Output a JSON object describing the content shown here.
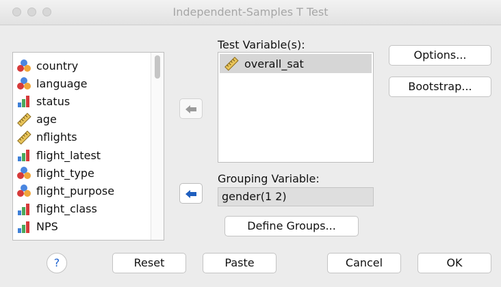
{
  "window": {
    "title": "Independent-Samples T Test"
  },
  "variables": [
    {
      "label": "country",
      "icon": "nominal-icon"
    },
    {
      "label": "language",
      "icon": "nominal-icon"
    },
    {
      "label": "status",
      "icon": "ordinal-icon"
    },
    {
      "label": "age",
      "icon": "scale-icon"
    },
    {
      "label": "nflights",
      "icon": "scale-icon"
    },
    {
      "label": "flight_latest",
      "icon": "ordinal-icon"
    },
    {
      "label": "flight_type",
      "icon": "nominal-icon"
    },
    {
      "label": "flight_purpose",
      "icon": "nominal-icon"
    },
    {
      "label": "flight_class",
      "icon": "ordinal-icon"
    },
    {
      "label": "NPS",
      "icon": "ordinal-icon"
    }
  ],
  "test_variables": {
    "label": "Test Variable(s):",
    "items": [
      {
        "label": "overall_sat",
        "icon": "scale-icon"
      }
    ]
  },
  "grouping": {
    "label": "Grouping Variable:",
    "value": "gender(1 2)"
  },
  "buttons": {
    "options": "Options...",
    "bootstrap": "Bootstrap...",
    "define_groups": "Define Groups...",
    "help": "?",
    "reset": "Reset",
    "paste": "Paste",
    "cancel": "Cancel",
    "ok": "OK"
  },
  "colors": {
    "help_blue": "#1f63d0",
    "arrow_active": "#1f5fbf",
    "arrow_disabled": "#9a9a9a",
    "selection": "#d6d6d6"
  }
}
